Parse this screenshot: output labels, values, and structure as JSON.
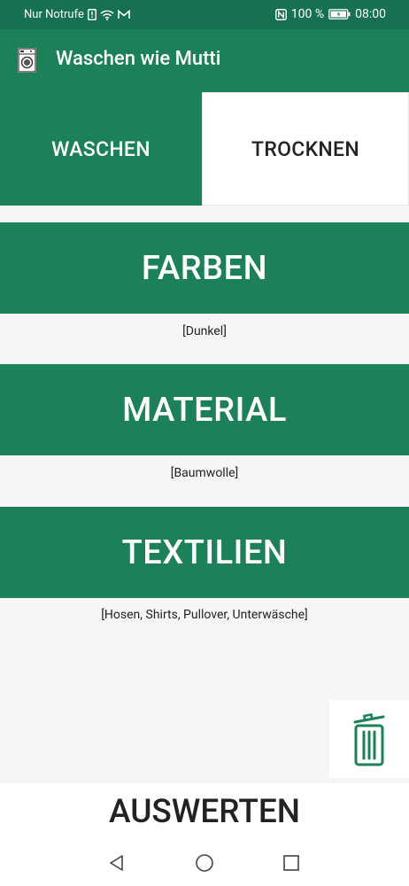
{
  "status_bar": {
    "carrier": "Nur Notrufe",
    "battery_percent": "100 %",
    "time": "08:00",
    "icons": [
      "sim-alert-icon",
      "wifi-icon",
      "gmail-icon",
      "nfc-icon",
      "battery-icon"
    ]
  },
  "app_bar": {
    "title": "Waschen wie Mutti",
    "icon": "washing-machine-icon"
  },
  "tabs": [
    {
      "label": "WASCHEN",
      "active": true
    },
    {
      "label": "TROCKNEN",
      "active": false
    }
  ],
  "categories": [
    {
      "label": "FARBEN",
      "selection": "[Dunkel]"
    },
    {
      "label": "MATERIAL",
      "selection": "[Baumwolle]"
    },
    {
      "label": "TEXTILIEN",
      "selection": "[Hosen, Shirts, Pullover, Unterwäsche]"
    }
  ],
  "actions": {
    "delete_icon": "trash-icon",
    "evaluate_label": "AUSWERTEN"
  },
  "nav": {
    "back_icon": "back-triangle-icon",
    "home_icon": "home-circle-icon",
    "recents_icon": "recents-square-icon"
  },
  "colors": {
    "primary": "#1c8158",
    "status_bar": "#167151",
    "background": "#f6f6f8"
  }
}
